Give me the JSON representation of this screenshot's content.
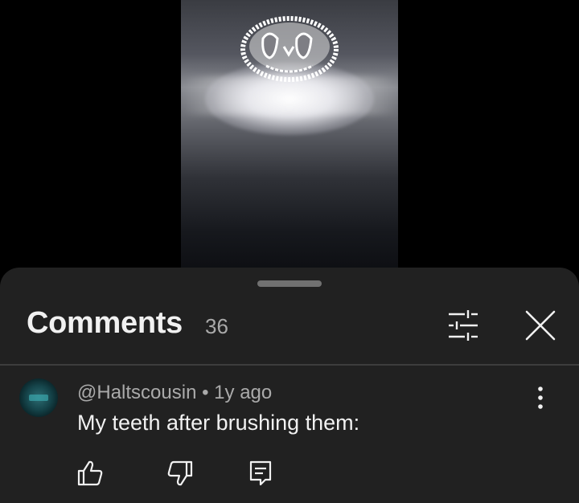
{
  "video": {
    "description_icon": "glowing-face-thumbnail"
  },
  "comments_panel": {
    "title": "Comments",
    "count": "36",
    "filter_icon": "sort-filter-icon",
    "close_icon": "close-icon"
  },
  "comments": [
    {
      "author": "@Haltscousin",
      "separator": "•",
      "time": "1y ago",
      "text": "My teeth after brushing them:",
      "actions": {
        "like_icon": "thumbs-up-icon",
        "dislike_icon": "thumbs-down-icon",
        "reply_icon": "reply-icon",
        "more_icon": "more-vertical-icon"
      }
    }
  ],
  "colors": {
    "sheet_background": "#212121",
    "primary_text": "#f1f1f1",
    "secondary_text": "#aaaaaa",
    "divider": "#3d3d3d"
  }
}
